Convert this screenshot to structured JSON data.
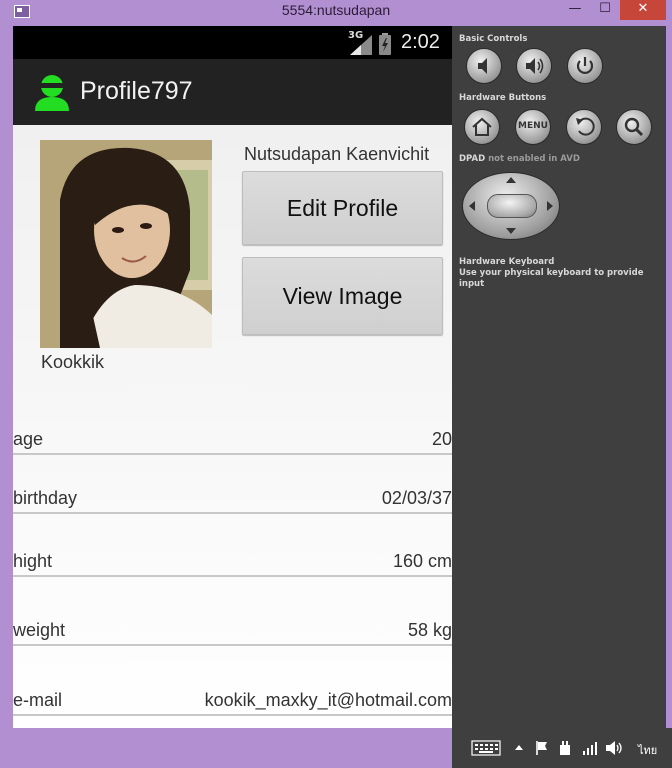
{
  "window": {
    "title": "5554:nutsudapan",
    "minimize": "—",
    "maximize": "☐",
    "close": "✕"
  },
  "statusbar": {
    "network": "3G",
    "time": "2:02"
  },
  "actionbar": {
    "title": "Profile797",
    "icon": "user-icon",
    "icon_color": "#22dd22"
  },
  "profile": {
    "nickname": "Kookkik",
    "full_name": "Nutsudapan Kaenvichit",
    "edit_button": "Edit Profile",
    "view_button": "View Image",
    "fields": [
      {
        "label": "age",
        "value": "20"
      },
      {
        "label": "birthday",
        "value": "02/03/37"
      },
      {
        "label": "hight",
        "value": "160 cm"
      },
      {
        "label": "weight",
        "value": "58 kg"
      },
      {
        "label": "e-mail",
        "value": "kookik_maxky_it@hotmail.com"
      }
    ]
  },
  "controls": {
    "basic_controls": "Basic Controls",
    "basic_buttons": [
      "volume-down-icon",
      "volume-up-icon",
      "power-icon"
    ],
    "hardware_buttons": "Hardware Buttons",
    "hardware_items": [
      "home-icon",
      "MENU",
      "back-icon",
      "search-icon"
    ],
    "dpad_label": "DPAD",
    "dpad_note": "not enabled in AVD",
    "keyboard_title": "Hardware Keyboard",
    "keyboard_note": "Use your physical keyboard to provide input"
  },
  "taskbar": {
    "language": "ไทย"
  }
}
